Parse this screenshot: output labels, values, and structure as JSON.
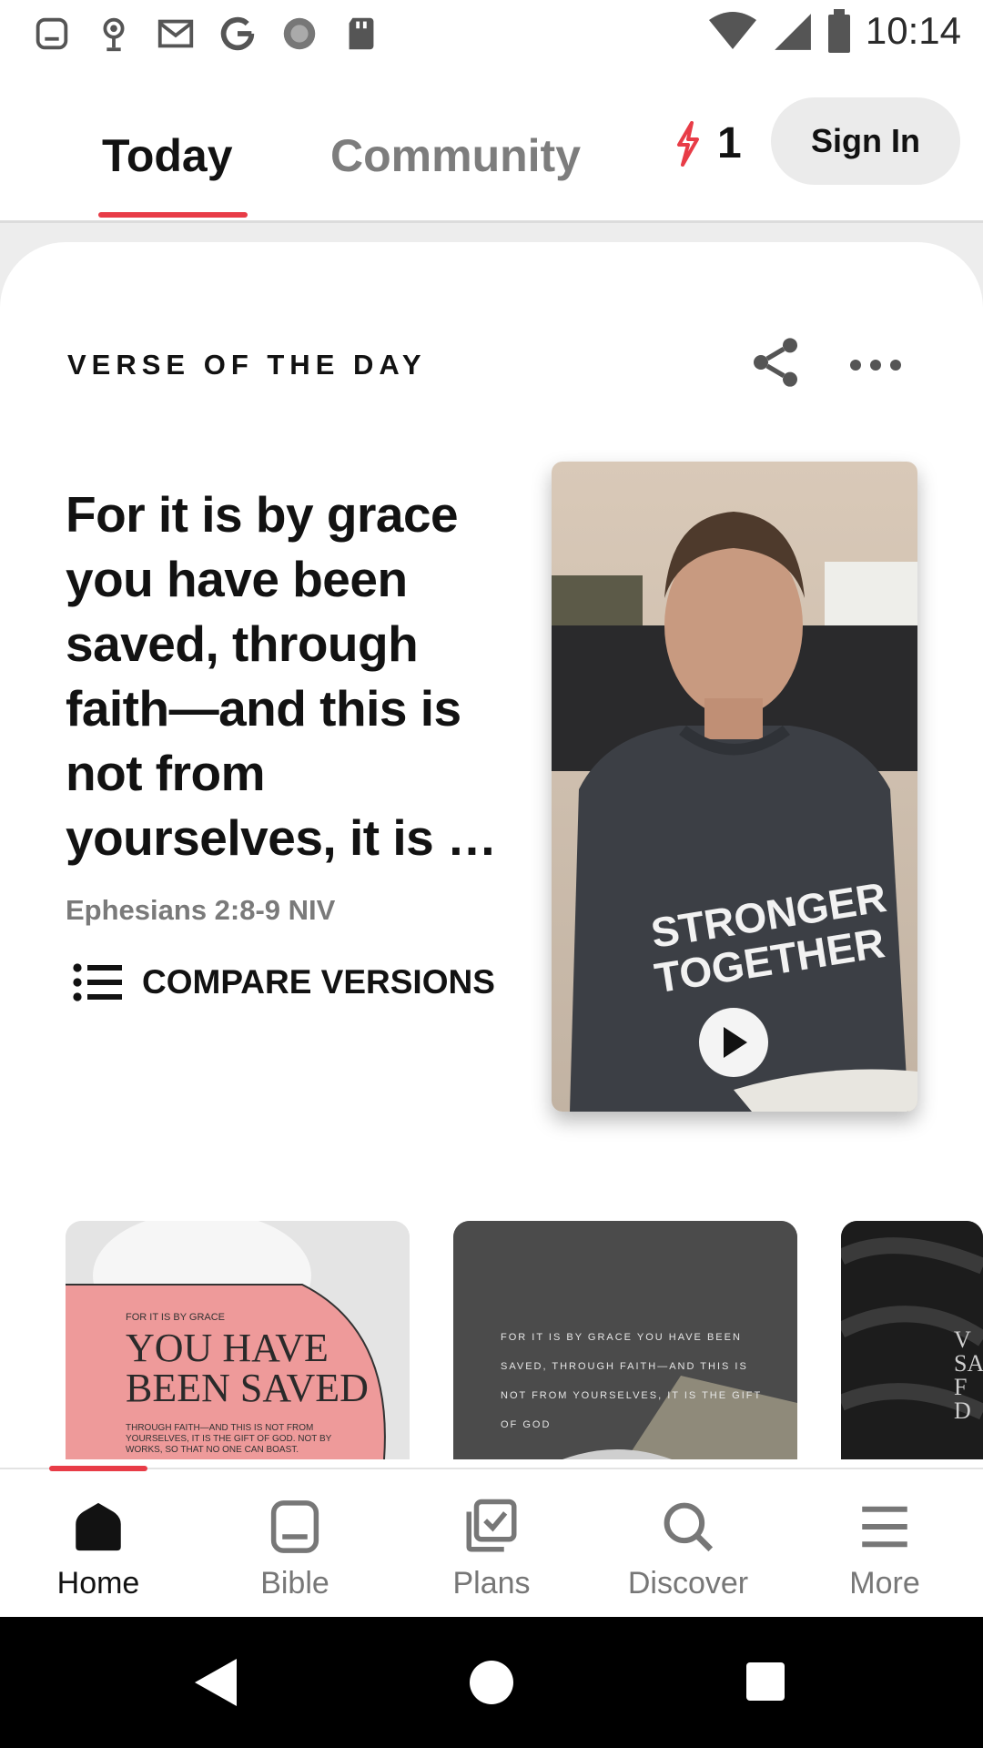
{
  "status_bar": {
    "time": "10:14",
    "notification_icons": [
      "tablet-icon",
      "podcast-icon",
      "gmail-icon",
      "google-icon",
      "circle-app-icon",
      "sd-card-icon"
    ],
    "system_icons": [
      "wifi-icon",
      "signal-icon",
      "battery-icon"
    ]
  },
  "header": {
    "tabs": [
      {
        "label": "Today",
        "active": true
      },
      {
        "label": "Community",
        "active": false
      }
    ],
    "streak_count": "1",
    "sign_in_label": "Sign In"
  },
  "verse_of_the_day": {
    "section_label": "VERSE OF THE DAY",
    "verse_text": "For it is by grace you have been saved, through faith—and this is not from yourselves, it is …",
    "reference": "Ephesians 2:8-9 NIV",
    "compare_label": "COMPARE VERSIONS",
    "video": {
      "shirt_text_line1": "STRONGER",
      "shirt_text_line2": "TOGETHER"
    }
  },
  "images": [
    {
      "small": "FOR IT IS BY GRACE",
      "big_line1": "YOU HAVE",
      "big_line2": "BEEN SAVED",
      "body": "THROUGH FAITH—AND THIS IS NOT FROM YOURSELVES, IT IS THE GIFT OF GOD. NOT BY WORKS, SO THAT NO ONE CAN BOAST."
    },
    {
      "body": "FOR IT IS BY GRACE YOU HAVE BEEN SAVED, THROUGH FAITH—AND THIS IS NOT FROM YOURSELVES, IT IS THE GIFT OF GOD"
    },
    {
      "partial_text": "V\nSA\nF\nD"
    }
  ],
  "bottom_nav": {
    "items": [
      {
        "label": "Home",
        "icon": "home-icon",
        "active": true
      },
      {
        "label": "Bible",
        "icon": "bible-icon",
        "active": false
      },
      {
        "label": "Plans",
        "icon": "plans-icon",
        "active": false
      },
      {
        "label": "Discover",
        "icon": "discover-icon",
        "active": false
      },
      {
        "label": "More",
        "icon": "menu-icon",
        "active": false
      }
    ]
  },
  "colors": {
    "accent": "#e83c47",
    "text_primary": "#121212",
    "text_muted": "#7a7a7a"
  }
}
